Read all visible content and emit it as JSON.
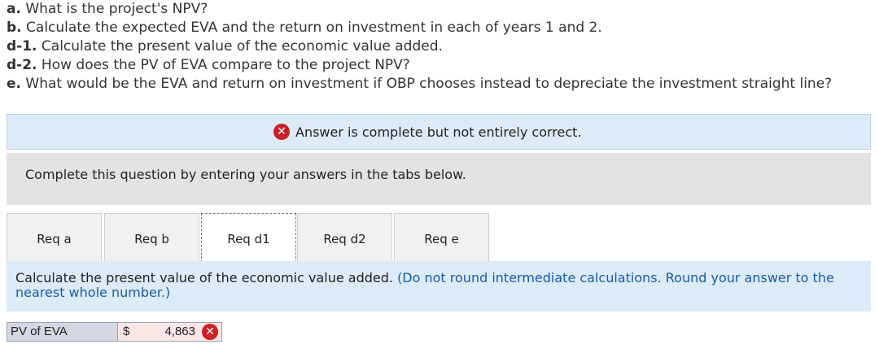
{
  "questions": [
    {
      "prefix": "a.",
      "text": " What is the project's NPV?"
    },
    {
      "prefix": "b.",
      "text": " Calculate the expected EVA and the return on investment in each of years 1 and 2."
    },
    {
      "prefix": "d-1.",
      "text": " Calculate the present value of the economic value added."
    },
    {
      "prefix": "d-2.",
      "text": " How does the PV of EVA compare to the project NPV?"
    },
    {
      "prefix": "e.",
      "text": " What would be the EVA and return on investment if OBP chooses instead to depreciate the investment straight line?"
    }
  ],
  "banner": {
    "icon": "x-circle-icon",
    "text": "Answer is complete but not entirely correct."
  },
  "instructions": "Complete this question by entering your answers in the tabs below.",
  "tabs": [
    {
      "label": "Req a",
      "active": false
    },
    {
      "label": "Req b",
      "active": false
    },
    {
      "label": "Req d1",
      "active": true
    },
    {
      "label": "Req d2",
      "active": false
    },
    {
      "label": "Req e",
      "active": false
    }
  ],
  "panel": {
    "prompt": "Calculate the present value of the economic value added. ",
    "note": "(Do not round intermediate calculations. Round your answer to the nearest whole number.)"
  },
  "answer": {
    "label": "PV of EVA",
    "currency": "$",
    "value": "4,863",
    "status": "incorrect"
  },
  "colors": {
    "error": "#cc1f26",
    "banner_bg": "#dcebf7",
    "instr_bg": "#e3e3e3",
    "note": "#1a5aa8",
    "answer_bg": "#fbe6e6"
  }
}
